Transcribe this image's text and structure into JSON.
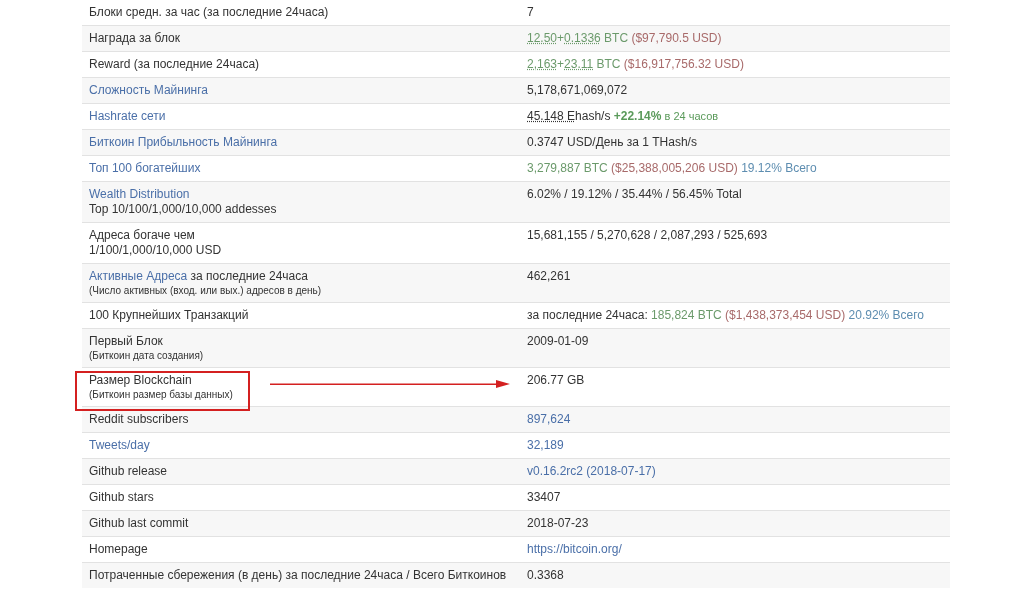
{
  "table": {
    "rows": [
      {
        "label": [
          [
            {
              "text": "Блоки средн. за час (за последние 24часа)",
              "kind": "plain"
            }
          ]
        ],
        "value": [
          {
            "text": "7",
            "kind": "plain"
          }
        ],
        "highlighted": false
      },
      {
        "label": [
          [
            {
              "text": "Награда за блок",
              "kind": "plain"
            }
          ]
        ],
        "value": [
          {
            "text": "12.50",
            "kind": "dotted"
          },
          {
            "text": "+",
            "kind": "green"
          },
          {
            "text": "0.1336",
            "kind": "dotted"
          },
          {
            "text": " BTC",
            "kind": "green"
          },
          {
            "text": " ($97,790.5 USD)",
            "kind": "red"
          }
        ],
        "highlighted": false
      },
      {
        "label": [
          [
            {
              "text": "Reward (за последние 24часа)",
              "kind": "plain"
            }
          ]
        ],
        "value": [
          {
            "text": "2,163",
            "kind": "dotted"
          },
          {
            "text": "+",
            "kind": "green"
          },
          {
            "text": "23.11",
            "kind": "dotted"
          },
          {
            "text": " BTC",
            "kind": "green"
          },
          {
            "text": " ($16,917,756.32 USD)",
            "kind": "red"
          }
        ],
        "highlighted": false
      },
      {
        "label": [
          [
            {
              "text": "Сложность Майнинга",
              "kind": "link"
            }
          ]
        ],
        "value": [
          {
            "text": "5,178,671,069,072",
            "kind": "plain"
          }
        ],
        "highlighted": false
      },
      {
        "label": [
          [
            {
              "text": "Hashrate сети",
              "kind": "link"
            }
          ]
        ],
        "value": [
          {
            "text": "45.148 E",
            "kind": "dotted-dark"
          },
          {
            "text": "hash/s",
            "kind": "plain"
          },
          {
            "text": " +22.14%",
            "kind": "green-bold"
          },
          {
            "text": " в 24 часов",
            "kind": "green-small"
          }
        ],
        "highlighted": false
      },
      {
        "label": [
          [
            {
              "text": "Биткоин Прибыльность Майнинга",
              "kind": "link"
            }
          ]
        ],
        "value": [
          {
            "text": "0.3747 USD/День за 1 THash/s",
            "kind": "plain"
          }
        ],
        "highlighted": false
      },
      {
        "label": [
          [
            {
              "text": "Топ 100 богатейших",
              "kind": "link"
            }
          ]
        ],
        "value": [
          {
            "text": "3,279,887 BTC",
            "kind": "green"
          },
          {
            "text": " ($25,388,005,206 USD)",
            "kind": "red"
          },
          {
            "text": " 19.12% Всего",
            "kind": "teal"
          }
        ],
        "highlighted": false
      },
      {
        "label": [
          [
            {
              "text": "Wealth Distribution",
              "kind": "link"
            }
          ],
          [
            {
              "text": "Top 10/100/1,000/10,000 addesses",
              "kind": "plain"
            }
          ]
        ],
        "value": [
          {
            "text": "6.02% / 19.12% / 35.44% / 56.45% Total",
            "kind": "plain"
          }
        ],
        "highlighted": false
      },
      {
        "label": [
          [
            {
              "text": "Адреса богаче чем",
              "kind": "plain"
            }
          ],
          [
            {
              "text": "1/100/1,000/10,000 USD",
              "kind": "plain"
            }
          ]
        ],
        "value": [
          {
            "text": "15,681,155 / 5,270,628 / 2,087,293 / 525,693",
            "kind": "plain"
          }
        ],
        "highlighted": false
      },
      {
        "label": [
          [
            {
              "text": "Активные Адреса",
              "kind": "link"
            },
            {
              "text": " за последние 24часа",
              "kind": "plain"
            }
          ],
          [
            {
              "text": "(Число активных (вход. или вых.) адресов в день)",
              "kind": "note"
            }
          ]
        ],
        "value": [
          {
            "text": "462,261",
            "kind": "plain"
          }
        ],
        "highlighted": false
      },
      {
        "label": [
          [
            {
              "text": "100 Крупнейших Транзакций",
              "kind": "plain"
            }
          ]
        ],
        "value": [
          {
            "text": "за последние 24часа: ",
            "kind": "plain"
          },
          {
            "text": "185,824 BTC",
            "kind": "green"
          },
          {
            "text": " ($1,438,373,454 USD)",
            "kind": "red"
          },
          {
            "text": " 20.92% Всего",
            "kind": "teal"
          }
        ],
        "highlighted": false
      },
      {
        "label": [
          [
            {
              "text": "Первый Блок",
              "kind": "plain"
            }
          ],
          [
            {
              "text": "(Биткоин дата создания)",
              "kind": "note"
            }
          ]
        ],
        "value": [
          {
            "text": "2009-01-09",
            "kind": "plain"
          }
        ],
        "highlighted": false
      },
      {
        "label": [
          [
            {
              "text": "Размер Blockchain",
              "kind": "plain"
            }
          ],
          [
            {
              "text": "(Биткоин размер базы данных)",
              "kind": "note"
            }
          ]
        ],
        "value": [
          {
            "text": "206.77 GB",
            "kind": "plain"
          }
        ],
        "highlighted": true
      },
      {
        "label": [
          [
            {
              "text": "Reddit subscribers",
              "kind": "plain"
            }
          ]
        ],
        "value": [
          {
            "text": "897,624",
            "kind": "link"
          }
        ],
        "highlighted": false
      },
      {
        "label": [
          [
            {
              "text": "Tweets/day",
              "kind": "link"
            }
          ]
        ],
        "value": [
          {
            "text": "32,189",
            "kind": "link"
          }
        ],
        "highlighted": false
      },
      {
        "label": [
          [
            {
              "text": "Github release",
              "kind": "plain"
            }
          ]
        ],
        "value": [
          {
            "text": "v0.16.2rc2 (2018-07-17)",
            "kind": "link"
          }
        ],
        "highlighted": false
      },
      {
        "label": [
          [
            {
              "text": "Github stars",
              "kind": "plain"
            }
          ]
        ],
        "value": [
          {
            "text": "33407",
            "kind": "plain"
          }
        ],
        "highlighted": false
      },
      {
        "label": [
          [
            {
              "text": "Github last commit",
              "kind": "plain"
            }
          ]
        ],
        "value": [
          {
            "text": "2018-07-23",
            "kind": "plain"
          }
        ],
        "highlighted": false
      },
      {
        "label": [
          [
            {
              "text": "Homepage",
              "kind": "plain"
            }
          ]
        ],
        "value": [
          {
            "text": "https://bitcoin.org/",
            "kind": "link"
          }
        ],
        "highlighted": false
      },
      {
        "label": [
          [
            {
              "text": "Потраченные сбережения (в день) за последние 24часа / Всего Биткоинов",
              "kind": "plain"
            }
          ]
        ],
        "value": [
          {
            "text": "0.3368",
            "kind": "plain"
          }
        ],
        "highlighted": false
      }
    ]
  }
}
